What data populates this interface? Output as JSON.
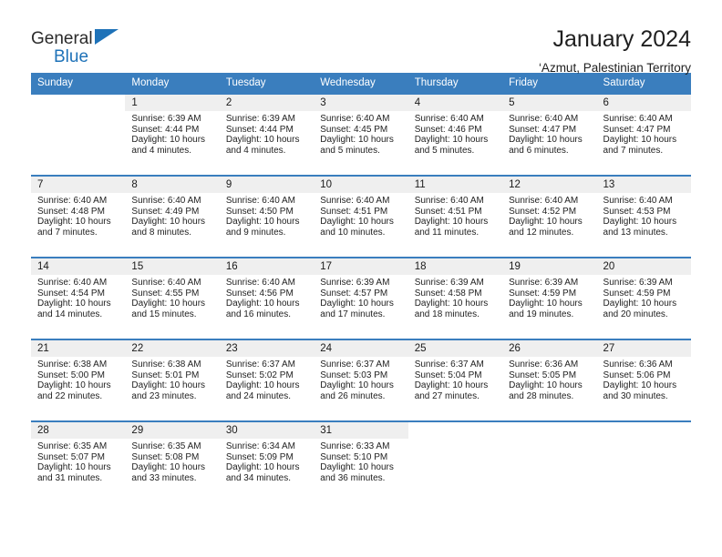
{
  "brand": {
    "name_top": "General",
    "name_bottom": "Blue",
    "triangle_color": "#1e72b8"
  },
  "header": {
    "title": "January 2024",
    "subtitle": "‘Azmut, Palestinian Territory"
  },
  "calendar": {
    "header_bg": "#3a7ebe",
    "daynum_bg": "#efefef",
    "weekday_headers": [
      "Sunday",
      "Monday",
      "Tuesday",
      "Wednesday",
      "Thursday",
      "Friday",
      "Saturday"
    ],
    "labels": {
      "sunrise": "Sunrise:",
      "sunset": "Sunset:",
      "daylight": "Daylight:"
    },
    "weeks": [
      [
        {
          "day": "",
          "sunrise": "",
          "sunset": "",
          "daylight_line1": "",
          "daylight_line2": ""
        },
        {
          "day": "1",
          "sunrise": "Sunrise: 6:39 AM",
          "sunset": "Sunset: 4:44 PM",
          "daylight_line1": "Daylight: 10 hours",
          "daylight_line2": "and 4 minutes."
        },
        {
          "day": "2",
          "sunrise": "Sunrise: 6:39 AM",
          "sunset": "Sunset: 4:44 PM",
          "daylight_line1": "Daylight: 10 hours",
          "daylight_line2": "and 4 minutes."
        },
        {
          "day": "3",
          "sunrise": "Sunrise: 6:40 AM",
          "sunset": "Sunset: 4:45 PM",
          "daylight_line1": "Daylight: 10 hours",
          "daylight_line2": "and 5 minutes."
        },
        {
          "day": "4",
          "sunrise": "Sunrise: 6:40 AM",
          "sunset": "Sunset: 4:46 PM",
          "daylight_line1": "Daylight: 10 hours",
          "daylight_line2": "and 5 minutes."
        },
        {
          "day": "5",
          "sunrise": "Sunrise: 6:40 AM",
          "sunset": "Sunset: 4:47 PM",
          "daylight_line1": "Daylight: 10 hours",
          "daylight_line2": "and 6 minutes."
        },
        {
          "day": "6",
          "sunrise": "Sunrise: 6:40 AM",
          "sunset": "Sunset: 4:47 PM",
          "daylight_line1": "Daylight: 10 hours",
          "daylight_line2": "and 7 minutes."
        }
      ],
      [
        {
          "day": "7",
          "sunrise": "Sunrise: 6:40 AM",
          "sunset": "Sunset: 4:48 PM",
          "daylight_line1": "Daylight: 10 hours",
          "daylight_line2": "and 7 minutes."
        },
        {
          "day": "8",
          "sunrise": "Sunrise: 6:40 AM",
          "sunset": "Sunset: 4:49 PM",
          "daylight_line1": "Daylight: 10 hours",
          "daylight_line2": "and 8 minutes."
        },
        {
          "day": "9",
          "sunrise": "Sunrise: 6:40 AM",
          "sunset": "Sunset: 4:50 PM",
          "daylight_line1": "Daylight: 10 hours",
          "daylight_line2": "and 9 minutes."
        },
        {
          "day": "10",
          "sunrise": "Sunrise: 6:40 AM",
          "sunset": "Sunset: 4:51 PM",
          "daylight_line1": "Daylight: 10 hours",
          "daylight_line2": "and 10 minutes."
        },
        {
          "day": "11",
          "sunrise": "Sunrise: 6:40 AM",
          "sunset": "Sunset: 4:51 PM",
          "daylight_line1": "Daylight: 10 hours",
          "daylight_line2": "and 11 minutes."
        },
        {
          "day": "12",
          "sunrise": "Sunrise: 6:40 AM",
          "sunset": "Sunset: 4:52 PM",
          "daylight_line1": "Daylight: 10 hours",
          "daylight_line2": "and 12 minutes."
        },
        {
          "day": "13",
          "sunrise": "Sunrise: 6:40 AM",
          "sunset": "Sunset: 4:53 PM",
          "daylight_line1": "Daylight: 10 hours",
          "daylight_line2": "and 13 minutes."
        }
      ],
      [
        {
          "day": "14",
          "sunrise": "Sunrise: 6:40 AM",
          "sunset": "Sunset: 4:54 PM",
          "daylight_line1": "Daylight: 10 hours",
          "daylight_line2": "and 14 minutes."
        },
        {
          "day": "15",
          "sunrise": "Sunrise: 6:40 AM",
          "sunset": "Sunset: 4:55 PM",
          "daylight_line1": "Daylight: 10 hours",
          "daylight_line2": "and 15 minutes."
        },
        {
          "day": "16",
          "sunrise": "Sunrise: 6:40 AM",
          "sunset": "Sunset: 4:56 PM",
          "daylight_line1": "Daylight: 10 hours",
          "daylight_line2": "and 16 minutes."
        },
        {
          "day": "17",
          "sunrise": "Sunrise: 6:39 AM",
          "sunset": "Sunset: 4:57 PM",
          "daylight_line1": "Daylight: 10 hours",
          "daylight_line2": "and 17 minutes."
        },
        {
          "day": "18",
          "sunrise": "Sunrise: 6:39 AM",
          "sunset": "Sunset: 4:58 PM",
          "daylight_line1": "Daylight: 10 hours",
          "daylight_line2": "and 18 minutes."
        },
        {
          "day": "19",
          "sunrise": "Sunrise: 6:39 AM",
          "sunset": "Sunset: 4:59 PM",
          "daylight_line1": "Daylight: 10 hours",
          "daylight_line2": "and 19 minutes."
        },
        {
          "day": "20",
          "sunrise": "Sunrise: 6:39 AM",
          "sunset": "Sunset: 4:59 PM",
          "daylight_line1": "Daylight: 10 hours",
          "daylight_line2": "and 20 minutes."
        }
      ],
      [
        {
          "day": "21",
          "sunrise": "Sunrise: 6:38 AM",
          "sunset": "Sunset: 5:00 PM",
          "daylight_line1": "Daylight: 10 hours",
          "daylight_line2": "and 22 minutes."
        },
        {
          "day": "22",
          "sunrise": "Sunrise: 6:38 AM",
          "sunset": "Sunset: 5:01 PM",
          "daylight_line1": "Daylight: 10 hours",
          "daylight_line2": "and 23 minutes."
        },
        {
          "day": "23",
          "sunrise": "Sunrise: 6:37 AM",
          "sunset": "Sunset: 5:02 PM",
          "daylight_line1": "Daylight: 10 hours",
          "daylight_line2": "and 24 minutes."
        },
        {
          "day": "24",
          "sunrise": "Sunrise: 6:37 AM",
          "sunset": "Sunset: 5:03 PM",
          "daylight_line1": "Daylight: 10 hours",
          "daylight_line2": "and 26 minutes."
        },
        {
          "day": "25",
          "sunrise": "Sunrise: 6:37 AM",
          "sunset": "Sunset: 5:04 PM",
          "daylight_line1": "Daylight: 10 hours",
          "daylight_line2": "and 27 minutes."
        },
        {
          "day": "26",
          "sunrise": "Sunrise: 6:36 AM",
          "sunset": "Sunset: 5:05 PM",
          "daylight_line1": "Daylight: 10 hours",
          "daylight_line2": "and 28 minutes."
        },
        {
          "day": "27",
          "sunrise": "Sunrise: 6:36 AM",
          "sunset": "Sunset: 5:06 PM",
          "daylight_line1": "Daylight: 10 hours",
          "daylight_line2": "and 30 minutes."
        }
      ],
      [
        {
          "day": "28",
          "sunrise": "Sunrise: 6:35 AM",
          "sunset": "Sunset: 5:07 PM",
          "daylight_line1": "Daylight: 10 hours",
          "daylight_line2": "and 31 minutes."
        },
        {
          "day": "29",
          "sunrise": "Sunrise: 6:35 AM",
          "sunset": "Sunset: 5:08 PM",
          "daylight_line1": "Daylight: 10 hours",
          "daylight_line2": "and 33 minutes."
        },
        {
          "day": "30",
          "sunrise": "Sunrise: 6:34 AM",
          "sunset": "Sunset: 5:09 PM",
          "daylight_line1": "Daylight: 10 hours",
          "daylight_line2": "and 34 minutes."
        },
        {
          "day": "31",
          "sunrise": "Sunrise: 6:33 AM",
          "sunset": "Sunset: 5:10 PM",
          "daylight_line1": "Daylight: 10 hours",
          "daylight_line2": "and 36 minutes."
        },
        {
          "day": "",
          "sunrise": "",
          "sunset": "",
          "daylight_line1": "",
          "daylight_line2": ""
        },
        {
          "day": "",
          "sunrise": "",
          "sunset": "",
          "daylight_line1": "",
          "daylight_line2": ""
        },
        {
          "day": "",
          "sunrise": "",
          "sunset": "",
          "daylight_line1": "",
          "daylight_line2": ""
        }
      ]
    ]
  }
}
